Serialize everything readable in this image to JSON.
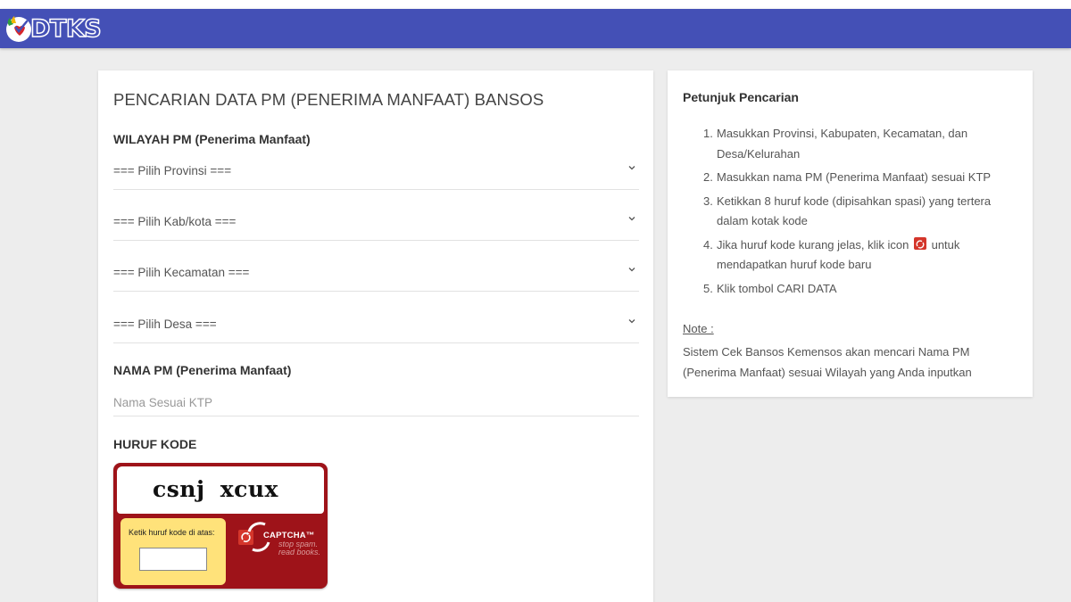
{
  "header": {
    "logo_text": "DTKS",
    "brand_color": "#4450b6"
  },
  "form": {
    "title": "PENCARIAN DATA PM (PENERIMA MANFAAT) BANSOS",
    "region_label": "WILAYAH PM (Penerima Manfaat)",
    "selects": {
      "province": "=== Pilih Provinsi ===",
      "regency": "=== Pilih Kab/kota ===",
      "district": "=== Pilih Kecamatan ===",
      "village": "=== Pilih Desa ==="
    },
    "name_label": "NAMA PM (Penerima Manfaat)",
    "name_placeholder": "Nama Sesuai KTP",
    "code_label": "HURUF KODE"
  },
  "captcha": {
    "word": "csnj xcux",
    "entry_label": "Ketik huruf kode di atas:",
    "brand": "CAPTCHA™",
    "tagline_1": "stop spam.",
    "tagline_2": "read books.",
    "panel_color": "#9e1319",
    "entry_color": "#ffe27a"
  },
  "instructions": {
    "title": "Petunjuk Pencarian",
    "steps": [
      {
        "num": "1.",
        "text": "Masukkan Provinsi, Kabupaten, Kecamatan, dan Desa/Kelurahan"
      },
      {
        "num": "2.",
        "text": "Masukkan nama PM (Penerima Manfaat) sesuai KTP"
      },
      {
        "num": "3.",
        "text": "Ketikkan 8 huruf kode (dipisahkan spasi) yang tertera dalam kotak kode"
      },
      {
        "num": "4.",
        "text_before": "Jika huruf kode kurang jelas, klik icon",
        "text_after": "untuk mendapatkan huruf kode baru"
      },
      {
        "num": "5.",
        "text": "Klik tombol CARI DATA"
      }
    ],
    "note_label": "Note :",
    "note_text": "Sistem Cek Bansos Kemensos akan mencari Nama PM (Penerima Manfaat) sesuai Wilayah yang Anda inputkan"
  }
}
